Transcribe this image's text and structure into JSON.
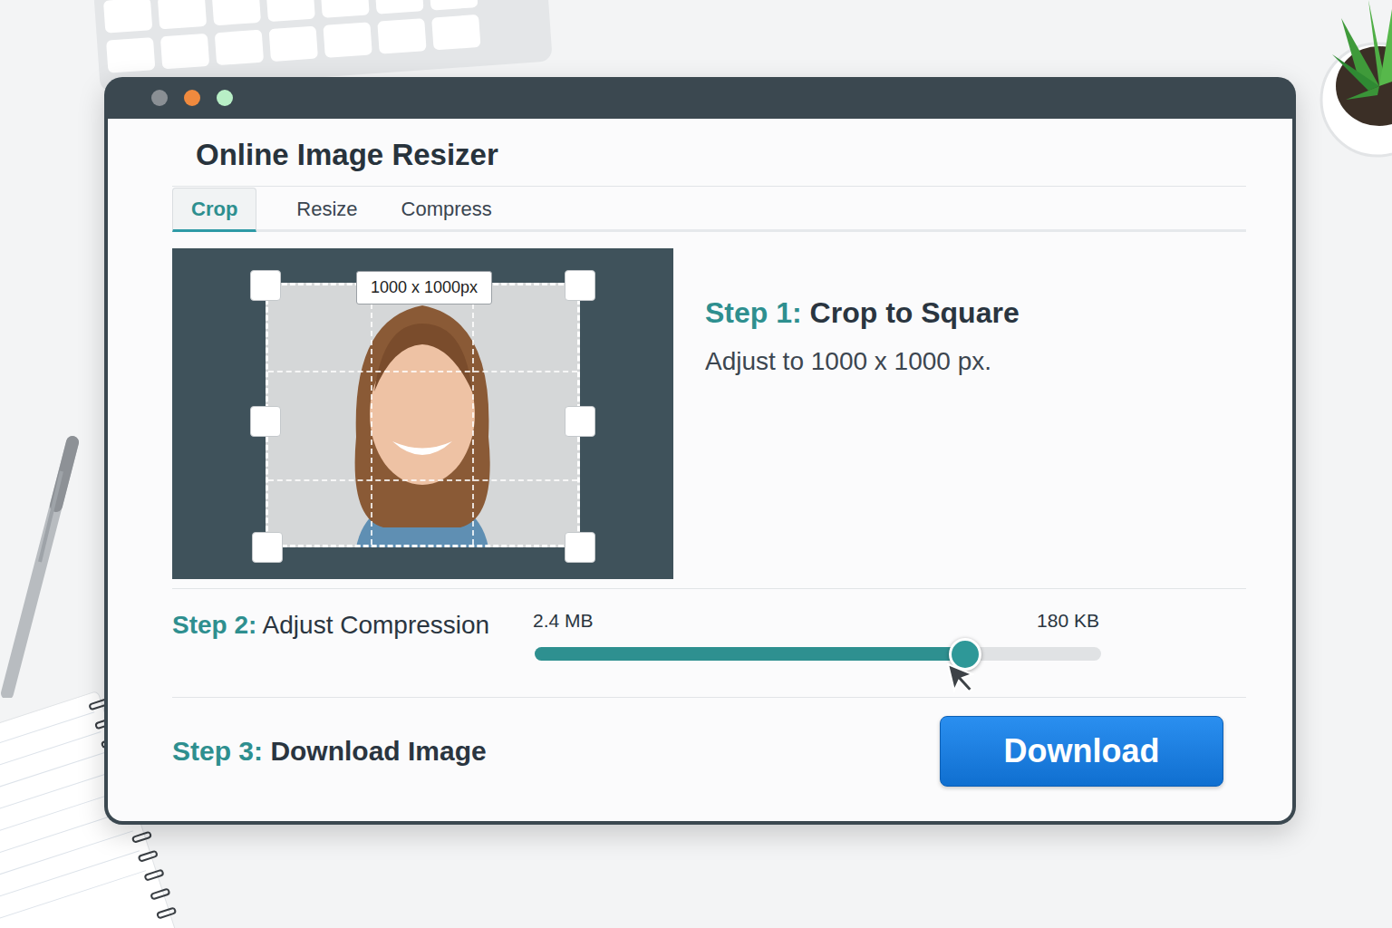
{
  "window": {
    "title": "Online Image Resizer",
    "controls": [
      {
        "color": "#8a8f94"
      },
      {
        "color": "#f08a3e"
      },
      {
        "color": "#b8efc6"
      }
    ]
  },
  "tabs": [
    {
      "label": "Crop",
      "selected": true
    },
    {
      "label": "Resize",
      "selected": false
    },
    {
      "label": "Compress",
      "selected": false
    }
  ],
  "crop": {
    "size_label": "1000 x 1000px"
  },
  "step1": {
    "number": "Step 1:",
    "title": "Crop to Square",
    "description": "Adjust to 1000 x 1000 px."
  },
  "step2": {
    "number": "Step 2:",
    "title": "Adjust Compression",
    "min_label": "2.4 MB",
    "max_label": "180 KB",
    "level": 0.76
  },
  "step3": {
    "number": "Step 3:",
    "title": "Download Image",
    "button": "Download"
  }
}
